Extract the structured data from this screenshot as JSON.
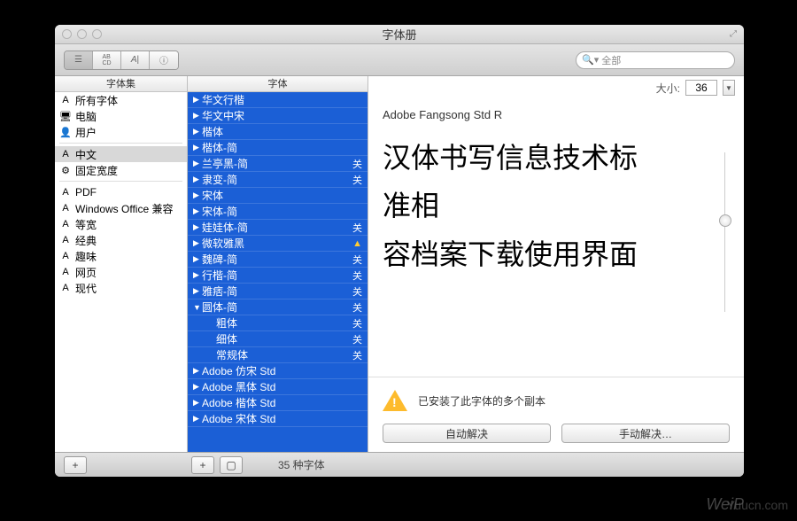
{
  "window": {
    "title": "字体册"
  },
  "toolbar": {
    "search_placeholder": "全部"
  },
  "collections": {
    "header": "字体集",
    "items": [
      {
        "icon": "A",
        "label": "所有字体"
      },
      {
        "icon": "🖥",
        "label": "电脑"
      },
      {
        "icon": "👤",
        "label": "用户"
      },
      {
        "divider": true
      },
      {
        "icon": "A",
        "label": "中文",
        "selected": true
      },
      {
        "icon": "⚙",
        "label": "固定宽度"
      },
      {
        "divider": true
      },
      {
        "icon": "A",
        "label": "PDF"
      },
      {
        "icon": "A",
        "label": "Windows Office 兼容"
      },
      {
        "icon": "A",
        "label": "等宽"
      },
      {
        "icon": "A",
        "label": "经典"
      },
      {
        "icon": "A",
        "label": "趣味"
      },
      {
        "icon": "A",
        "label": "网页"
      },
      {
        "icon": "A",
        "label": "现代"
      }
    ]
  },
  "fonts": {
    "header": "字体",
    "items": [
      {
        "arrow": "▶",
        "label": "华文行楷"
      },
      {
        "arrow": "▶",
        "label": "华文中宋"
      },
      {
        "arrow": "▶",
        "label": "楷体"
      },
      {
        "arrow": "▶",
        "label": "楷体-简"
      },
      {
        "arrow": "▶",
        "label": "兰亭黑-简",
        "badge": "关"
      },
      {
        "arrow": "▶",
        "label": "隶变-简",
        "badge": "关"
      },
      {
        "arrow": "▶",
        "label": "宋体"
      },
      {
        "arrow": "▶",
        "label": "宋体-简"
      },
      {
        "arrow": "▶",
        "label": "娃娃体-简",
        "badge": "关"
      },
      {
        "arrow": "▶",
        "label": "微软雅黑",
        "badge": "▲",
        "badgeColor": "#ffcc33"
      },
      {
        "arrow": "▶",
        "label": "魏碑-简",
        "badge": "关"
      },
      {
        "arrow": "▶",
        "label": "行楷-简",
        "badge": "关"
      },
      {
        "arrow": "▶",
        "label": "雅痞-简",
        "badge": "关"
      },
      {
        "arrow": "▼",
        "label": "圆体-简",
        "badge": "关"
      },
      {
        "child": true,
        "label": "粗体",
        "badge": "关"
      },
      {
        "child": true,
        "label": "细体",
        "badge": "关"
      },
      {
        "child": true,
        "label": "常规体",
        "badge": "关"
      },
      {
        "arrow": "▶",
        "label": "Adobe 仿宋 Std"
      },
      {
        "arrow": "▶",
        "label": "Adobe 黑体 Std"
      },
      {
        "arrow": "▶",
        "label": "Adobe 楷体 Std"
      },
      {
        "arrow": "▶",
        "label": "Adobe 宋体 Std"
      }
    ]
  },
  "preview": {
    "size_label": "大小:",
    "size_value": "36",
    "font_name": "Adobe Fangsong Std R",
    "sample_line1": "汉体书写信息技术标",
    "sample_line2": "准相",
    "sample_line3": "容档案下载使用界面"
  },
  "warning": {
    "text": "已安装了此字体的多个副本",
    "auto_btn": "自动解决",
    "manual_btn": "手动解决…"
  },
  "status": {
    "count": "35 种字体"
  },
  "watermark": {
    "a": "WeiP",
    "b": "Yuucn.com"
  }
}
